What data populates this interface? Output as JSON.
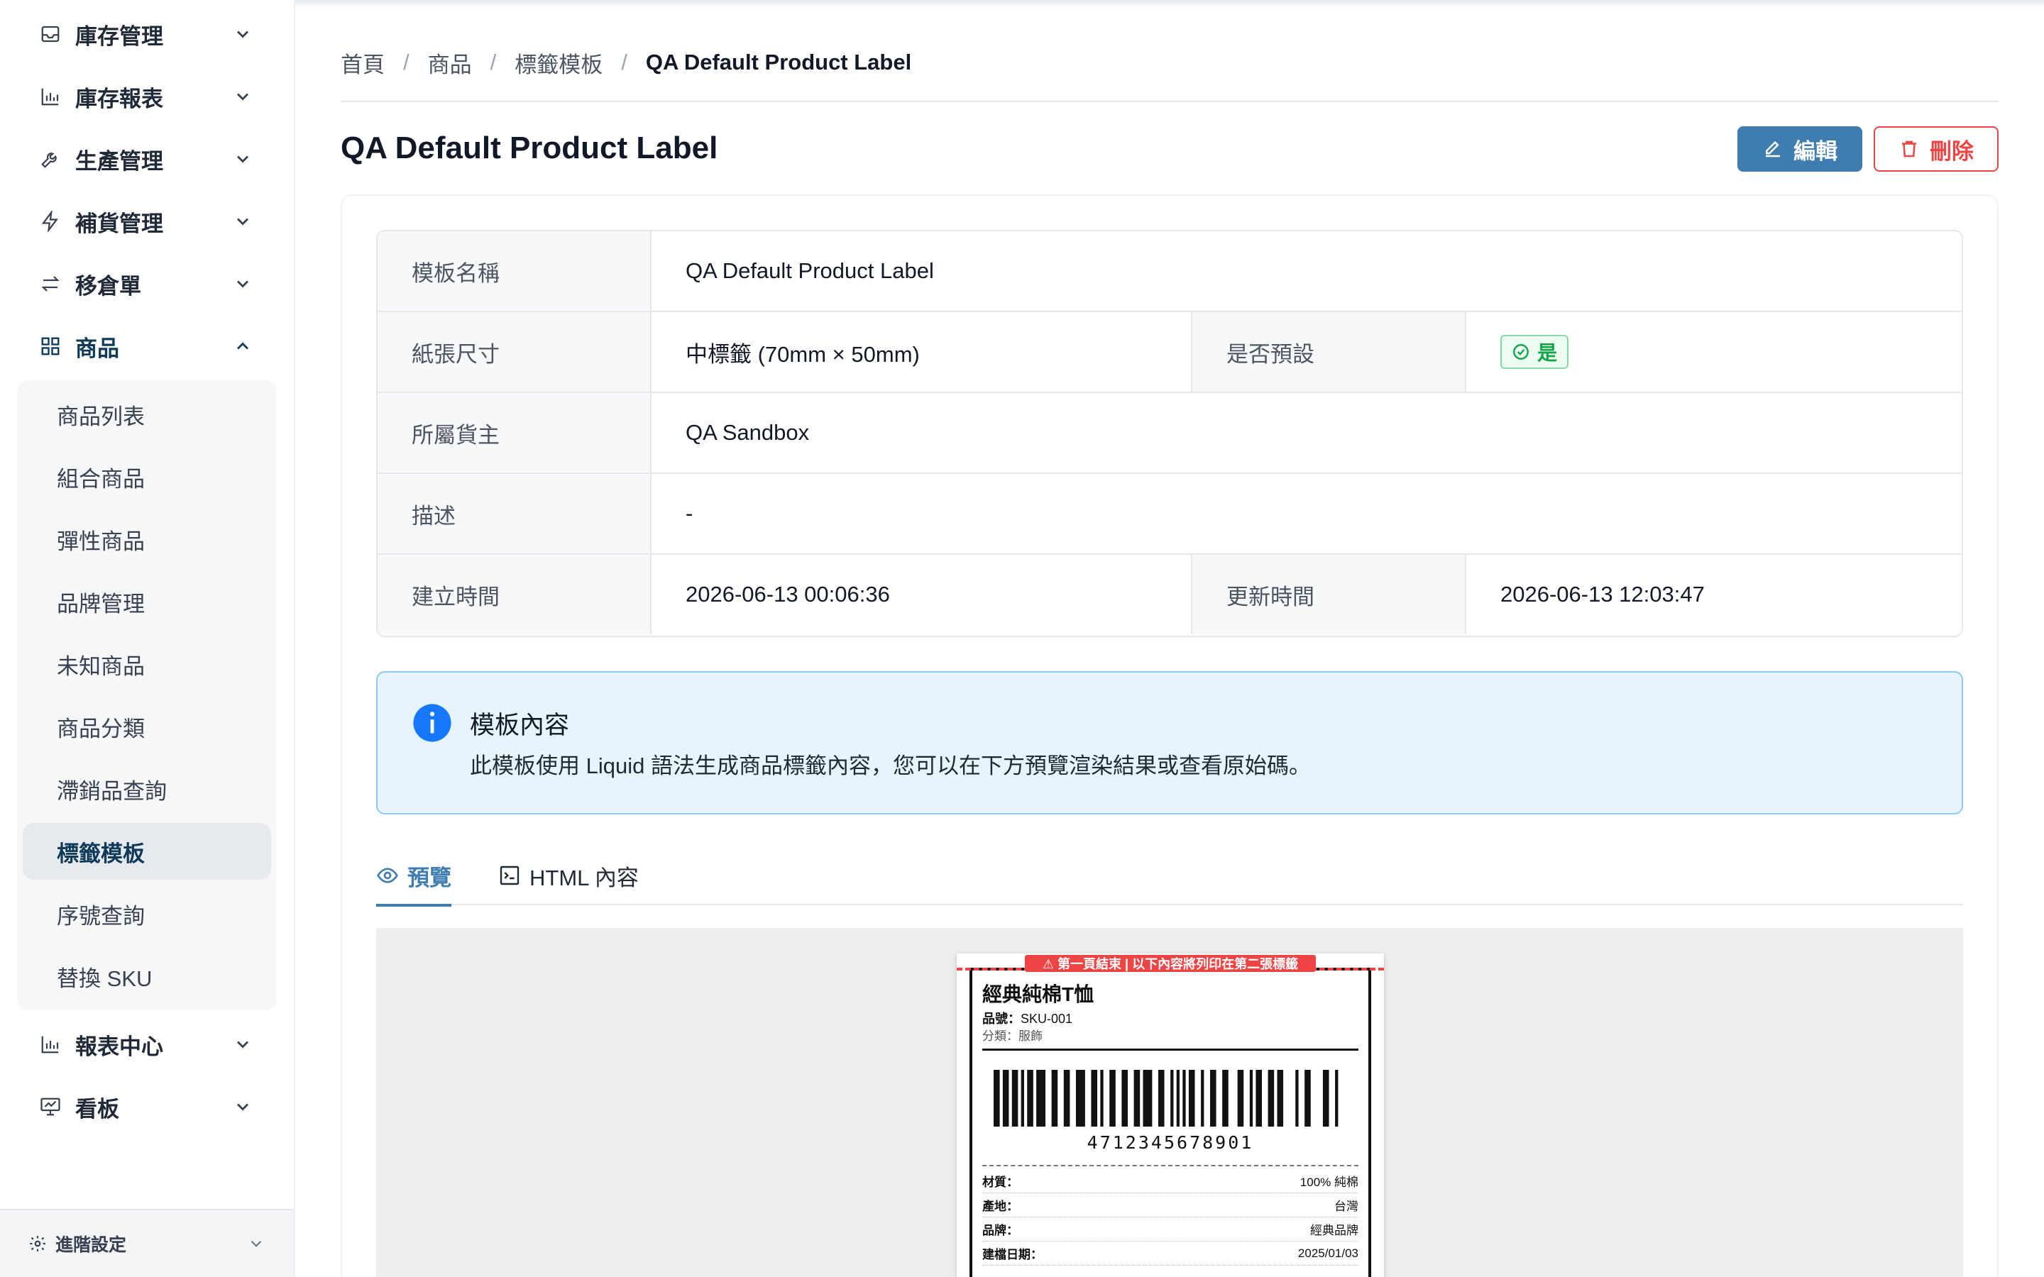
{
  "sidebar": {
    "items": [
      {
        "label": "庫存管理",
        "icon": "inbox-icon"
      },
      {
        "label": "庫存報表",
        "icon": "bar-chart-icon"
      },
      {
        "label": "生產管理",
        "icon": "wrench-icon"
      },
      {
        "label": "補貨管理",
        "icon": "lightning-icon"
      },
      {
        "label": "移倉單",
        "icon": "transfer-icon"
      },
      {
        "label": "商品",
        "icon": "grid-icon"
      },
      {
        "label": "報表中心",
        "icon": "bar-chart-icon"
      },
      {
        "label": "看板",
        "icon": "presentation-icon"
      }
    ],
    "sub_items": [
      "商品列表",
      "組合商品",
      "彈性商品",
      "品牌管理",
      "未知商品",
      "商品分類",
      "滯銷品查詢",
      "標籤模板",
      "序號查詢",
      "替換 SKU"
    ],
    "active_sub": "標籤模板",
    "footer_label": "進階設定"
  },
  "breadcrumb": {
    "items": [
      "首頁",
      "商品",
      "標籤模板"
    ],
    "current": "QA Default Product Label",
    "separator": "/"
  },
  "page": {
    "title": "QA Default Product Label",
    "edit_label": "編輯",
    "delete_label": "刪除"
  },
  "details": {
    "name_label": "模板名稱",
    "name_value": "QA Default Product Label",
    "paper_label": "紙張尺寸",
    "paper_value": "中標籤 (70mm × 50mm)",
    "default_label": "是否預設",
    "default_value": "是",
    "owner_label": "所屬貨主",
    "owner_value": "QA Sandbox",
    "desc_label": "描述",
    "desc_value": "-",
    "created_label": "建立時間",
    "created_value": "2026-06-13 00:06:36",
    "updated_label": "更新時間",
    "updated_value": "2026-06-13 12:03:47"
  },
  "alert": {
    "title": "模板內容",
    "text": "此模板使用 Liquid 語法生成商品標籤內容，您可以在下方預覽渲染結果或查看原始碼。"
  },
  "tabs": {
    "preview": "預覽",
    "html": "HTML 內容"
  },
  "label_preview": {
    "warning": "⚠ 第一頁結束 | 以下內容將列印在第二張標籤",
    "product_name": "經典純棉T恤",
    "sku_key": "品號：",
    "sku_value": "SKU-001",
    "category": "分類：服飾",
    "barcode_number": "4712345678901",
    "attributes": [
      {
        "key": "材質：",
        "value": "100% 純棉"
      },
      {
        "key": "產地：",
        "value": "台灣"
      },
      {
        "key": "品牌：",
        "value": "經典品牌"
      },
      {
        "key": "建檔日期：",
        "value": "2025/01/03"
      }
    ]
  },
  "colors": {
    "primary": "#3f7cb0",
    "danger": "#ef4444",
    "success": "#16a34a",
    "info_bg": "#e7f3fd",
    "info_icon": "#1677ff"
  }
}
